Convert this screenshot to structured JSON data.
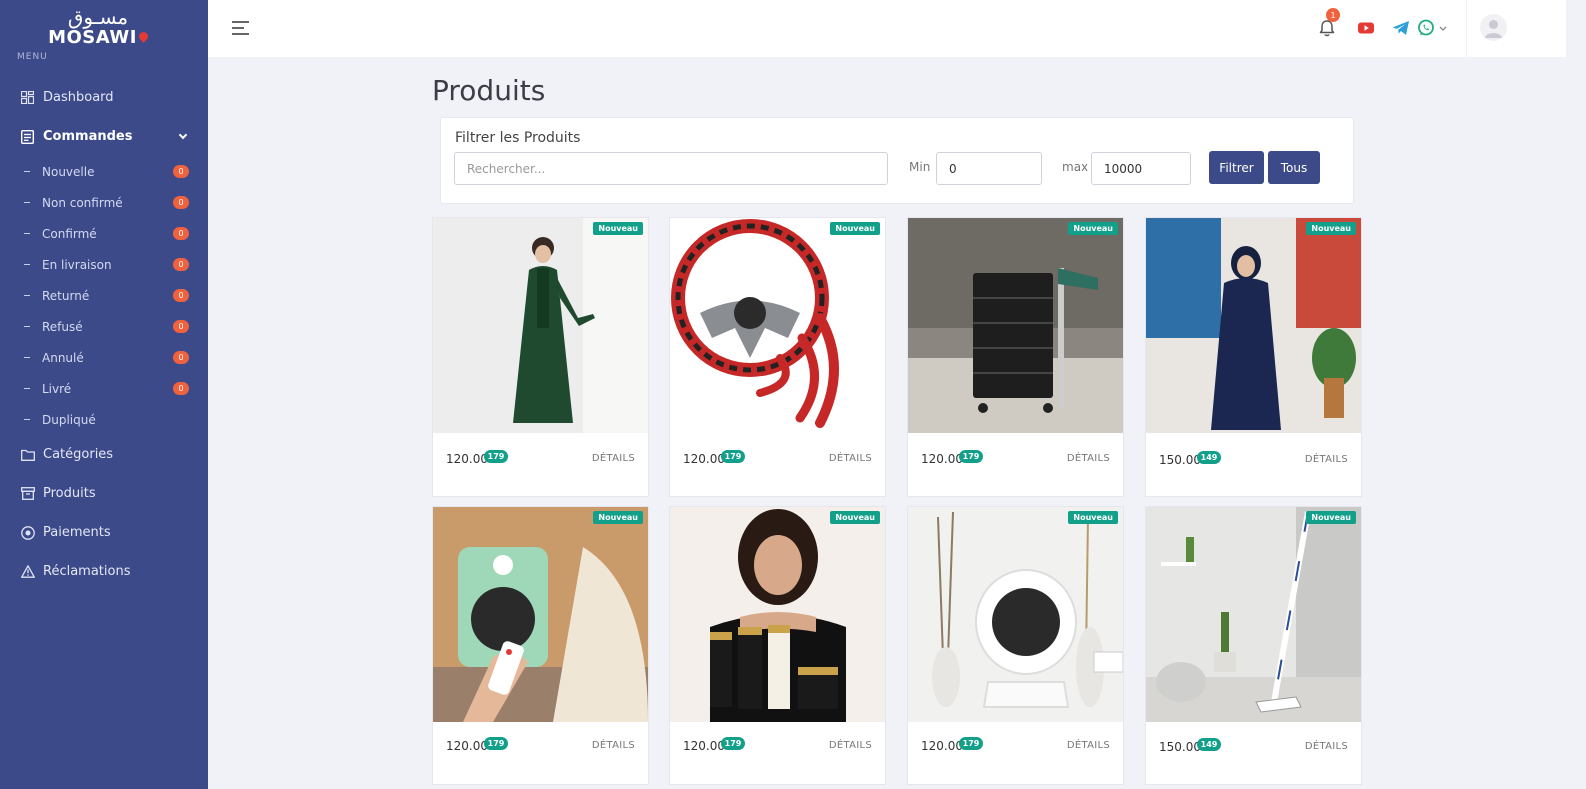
{
  "brand": {
    "logo_ar": "مسـوق",
    "logo_en": "MOSAWI"
  },
  "sidebar": {
    "menu_title": "MENU",
    "items": [
      {
        "label": "Dashboard",
        "icon": "dashboard-icon"
      },
      {
        "label": "Commandes",
        "icon": "orders-icon"
      },
      {
        "label": "Catégories",
        "icon": "folder-icon"
      },
      {
        "label": "Produits",
        "icon": "box-icon"
      },
      {
        "label": "Paiements",
        "icon": "coin-icon"
      },
      {
        "label": "Réclamations",
        "icon": "warning-icon"
      }
    ],
    "sub_items": [
      {
        "label": "Nouvelle",
        "count": "0"
      },
      {
        "label": "Non confirmé",
        "count": "0"
      },
      {
        "label": "Confirmé",
        "count": "0"
      },
      {
        "label": "En livraison",
        "count": "0"
      },
      {
        "label": "Returné",
        "count": "0"
      },
      {
        "label": "Refusé",
        "count": "0"
      },
      {
        "label": "Annulé",
        "count": "0"
      },
      {
        "label": "Livré",
        "count": "0"
      },
      {
        "label": "Dupliqué",
        "count": ""
      }
    ]
  },
  "header": {
    "notification_count": "1"
  },
  "main": {
    "title": "Produits",
    "filter": {
      "title": "Filtrer les Produits",
      "search_placeholder": "Rechercher...",
      "min_label": "Min",
      "min_value": "0",
      "max_label": "max",
      "max_value": "10000",
      "filter_button": "Filtrer",
      "all_button": "Tous"
    },
    "products": [
      {
        "tag": "Nouveau",
        "price": "120.00",
        "stock": "179",
        "details": "DÉTAILS"
      },
      {
        "tag": "Nouveau",
        "price": "120.00",
        "stock": "179",
        "details": "DÉTAILS"
      },
      {
        "tag": "Nouveau",
        "price": "120.00",
        "stock": "179",
        "details": "DÉTAILS"
      },
      {
        "tag": "Nouveau",
        "price": "150.00",
        "stock": "149",
        "details": "DÉTAILS"
      },
      {
        "tag": "Nouveau",
        "price": "120.00",
        "stock": "179",
        "details": "DÉTAILS"
      },
      {
        "tag": "Nouveau",
        "price": "120.00",
        "stock": "179",
        "details": "DÉTAILS"
      },
      {
        "tag": "Nouveau",
        "price": "120.00",
        "stock": "179",
        "details": "DÉTAILS"
      },
      {
        "tag": "Nouveau",
        "price": "150.00",
        "stock": "149",
        "details": "DÉTAILS"
      }
    ]
  },
  "colors": {
    "sidebar": "#3d4a8a",
    "accent": "#13a08a",
    "badge": "#f0623e",
    "background": "#f1f2f8"
  }
}
